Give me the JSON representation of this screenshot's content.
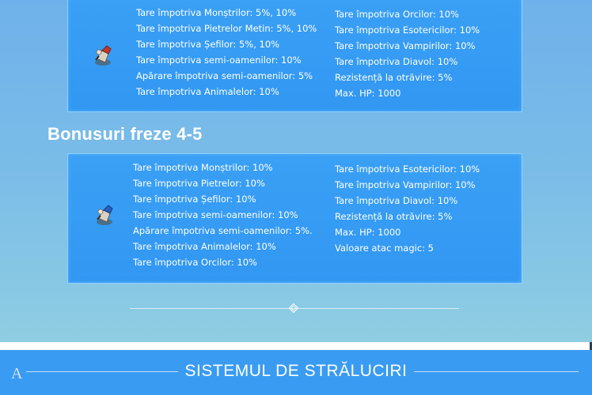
{
  "panel1": {
    "left_column": [
      "Tare împotriva Monștrilor: 5%, 10%",
      "Tare împotriva Pietrelor Metin: 5%, 10%",
      "Tare împotriva Șefilor: 5%, 10%",
      "Tare împotriva semi-oamenilor: 10%",
      "Apărare împotriva semi-oamenilor: 5%",
      "Tare împotriva Animalelor: 10%"
    ],
    "right_column": [
      "Tare împotriva Orcilor: 10%",
      "Tare împotriva Esotericilor: 10%",
      "Tare împotriva Vampirilor: 10%",
      "Tare împotriva Diavol: 10%",
      "Rezistență la otrăvire: 5%",
      "Max. HP: 1000"
    ]
  },
  "section_heading": "Bonusuri freze 4-5",
  "panel2": {
    "left_column": [
      "Tare împotriva Monștrilor: 10%",
      "Tare împotriva Pietrelor: 10%",
      "Tare împotriva Șefilor: 10%",
      "Tare împotriva semi-oamenilor: 10%",
      "Apărare împotriva semi-oamenilor: 5%.",
      "Tare împotriva Animalelor: 10%",
      "Tare împotriva Orcilor: 10%"
    ],
    "right_column": [
      "Tare împotriva Esotericilor: 10%",
      "Tare împotriva Vampirilor: 10%",
      "Tare împotriva Diavol: 10%",
      "Rezistență la otrăvire: 5%",
      "Max. HP: 1000",
      "Valoare atac magic: 5"
    ]
  },
  "footer": {
    "logo": "A",
    "title": "SISTEMUL DE STRĂLUCIRI"
  },
  "icons": {
    "item_icon_1": "enchanted-item-red-icon",
    "item_icon_2": "enchanted-item-blue-icon",
    "divider_ornament": "diamond-ornament-icon"
  }
}
